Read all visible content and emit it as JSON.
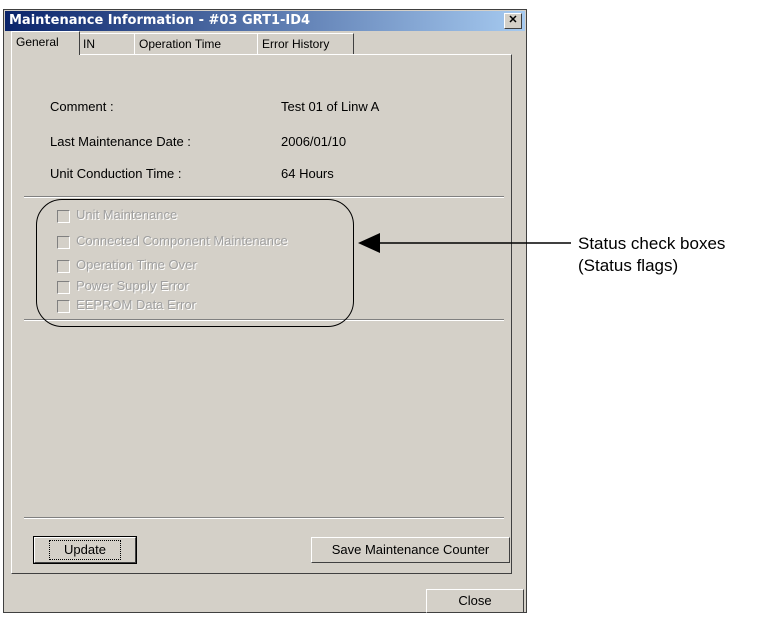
{
  "window": {
    "title": "Maintenance Information - #03 GRT1-ID4",
    "close_glyph": "✕"
  },
  "tabs": [
    {
      "label": "General"
    },
    {
      "label": "IN"
    },
    {
      "label": "Operation Time"
    },
    {
      "label": "Error History"
    }
  ],
  "info": [
    {
      "label": "Comment :",
      "value": "Test 01 of Linw A"
    },
    {
      "label": "Last Maintenance Date :",
      "value": "2006/01/10"
    },
    {
      "label": "Unit Conduction Time :",
      "value": "64 Hours"
    }
  ],
  "status_flags": [
    {
      "label": "Unit Maintenance",
      "checked": false
    },
    {
      "label": "Connected Component Maintenance",
      "checked": false
    },
    {
      "label": "Operation Time Over",
      "checked": false
    },
    {
      "label": "Power Supply Error",
      "checked": false
    },
    {
      "label": "EEPROM Data Error",
      "checked": false
    }
  ],
  "buttons": {
    "update": "Update",
    "save_counter": "Save Maintenance Counter",
    "close": "Close"
  },
  "annotation": {
    "line1": "Status check boxes",
    "line2": "(Status flags)"
  }
}
